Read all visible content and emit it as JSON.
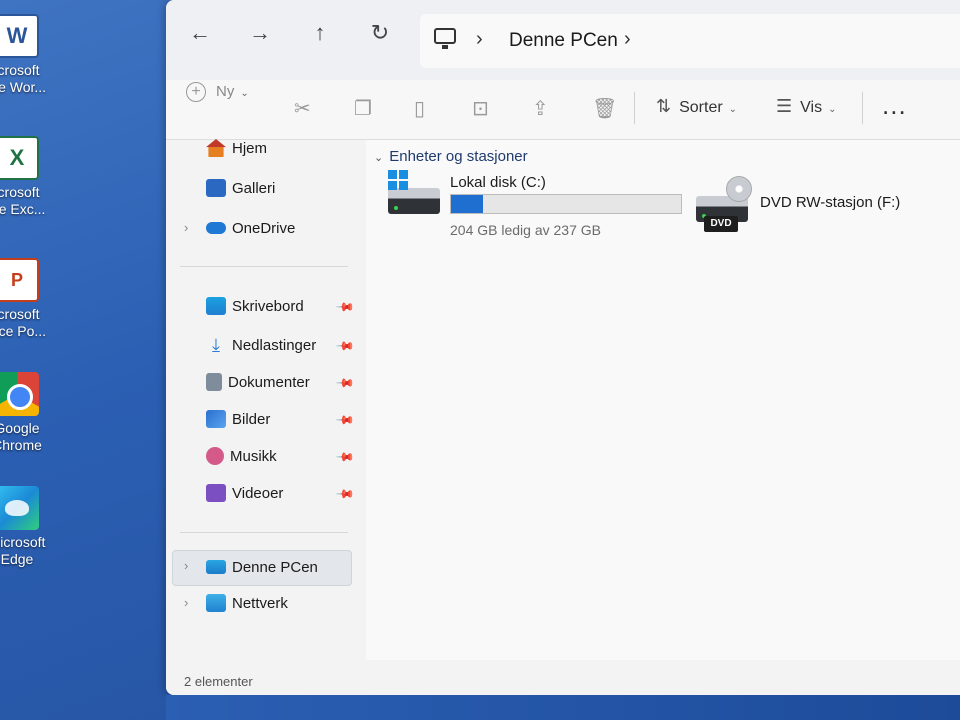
{
  "desktop": {
    "icons": [
      {
        "label1": "icrosoft",
        "label2": "ice Wor..."
      },
      {
        "label1": "icrosoft",
        "label2": "ice Exc..."
      },
      {
        "label1": "icrosoft",
        "label2": "ffice Po..."
      },
      {
        "label1": "Google",
        "label2": "Chrome"
      },
      {
        "label1": "Microsoft",
        "label2": "Edge"
      }
    ]
  },
  "address_bar": {
    "crumbs": [
      "Denne PCen"
    ]
  },
  "command_bar": {
    "new_label": "Ny",
    "sort_label": "Sorter",
    "view_label": "Vis",
    "more_label": "..."
  },
  "sidebar": {
    "top_items": [
      {
        "label": "Hjem",
        "icon": "home-icon"
      },
      {
        "label": "Galleri",
        "icon": "gallery-icon"
      },
      {
        "label": "OneDrive",
        "icon": "onedrive-icon"
      }
    ],
    "pinned_items": [
      {
        "label": "Skrivebord",
        "icon": "desktop-folder-icon"
      },
      {
        "label": "Nedlastinger",
        "icon": "downloads-icon"
      },
      {
        "label": "Dokumenter",
        "icon": "documents-icon"
      },
      {
        "label": "Bilder",
        "icon": "pictures-icon"
      },
      {
        "label": "Musikk",
        "icon": "music-icon"
      },
      {
        "label": "Videoer",
        "icon": "videos-icon"
      }
    ],
    "bottom_items": [
      {
        "label": "Denne PCen",
        "icon": "this-pc-icon",
        "selected": true
      },
      {
        "label": "Nettverk",
        "icon": "network-icon"
      }
    ]
  },
  "content": {
    "group_title": "Enheter og stasjoner",
    "drives": [
      {
        "name": "Lokal disk (C:)",
        "free_text": "204 GB ledig av 237 GB",
        "used_fraction": 0.14
      },
      {
        "name": "DVD RW-stasjon (F:)",
        "badge": "DVD"
      }
    ]
  },
  "status_bar": {
    "text": "2 elementer"
  }
}
